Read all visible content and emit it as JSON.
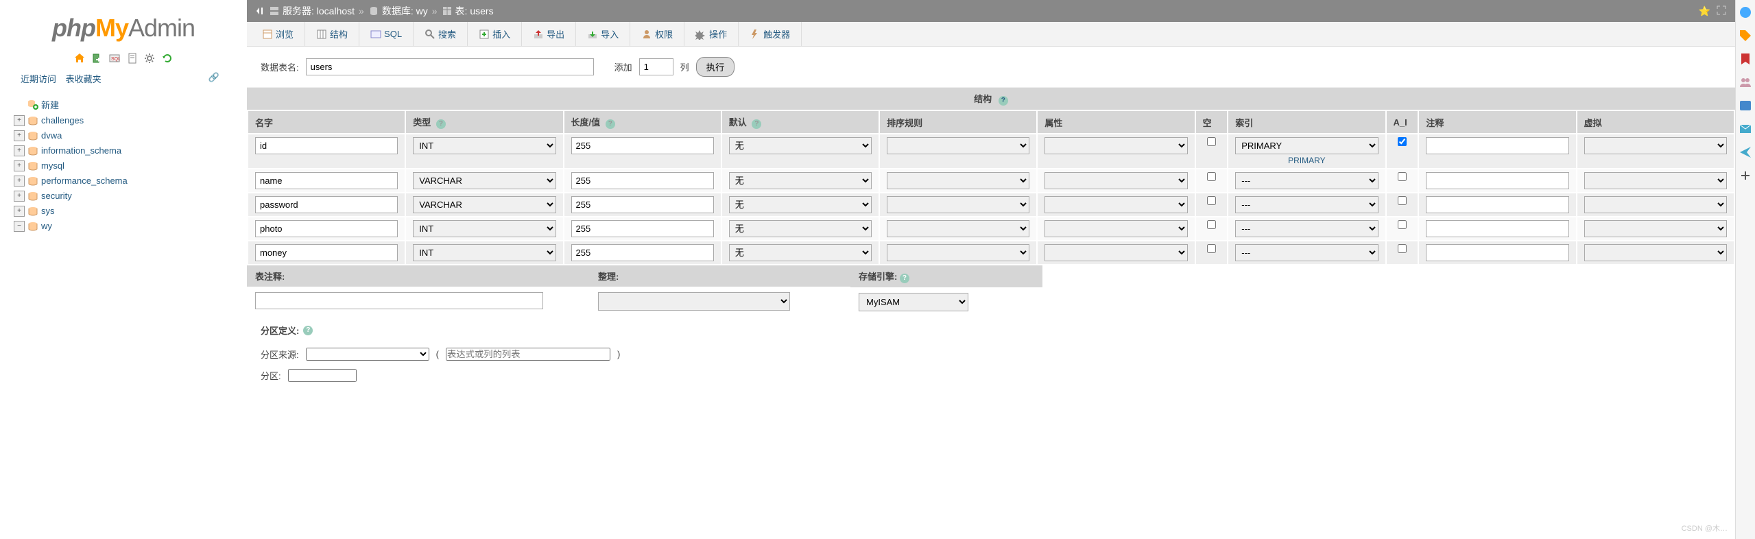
{
  "logo": {
    "part1": "php",
    "part2": "My",
    "part3": "Admin"
  },
  "nav_side": {
    "recent": "近期访问",
    "favorites": "表收藏夹"
  },
  "tree": {
    "new": "新建",
    "dbs": [
      "challenges",
      "dvwa",
      "information_schema",
      "mysql",
      "performance_schema",
      "security",
      "sys",
      "wy"
    ]
  },
  "breadcrumb": {
    "server_label": "服务器:",
    "server": "localhost",
    "db_label": "数据库:",
    "db": "wy",
    "table_label": "表:",
    "table": "users"
  },
  "tabs": [
    "浏览",
    "结构",
    "SQL",
    "搜索",
    "插入",
    "导出",
    "导入",
    "权限",
    "操作",
    "触发器"
  ],
  "form": {
    "table_name_label": "数据表名:",
    "table_name": "users",
    "add_label": "添加",
    "add_count": "1",
    "columns_label": "列",
    "execute": "执行"
  },
  "structure": {
    "title": "结构",
    "headers": {
      "name": "名字",
      "type": "类型",
      "length": "长度/值",
      "default": "默认",
      "collation": "排序规则",
      "attributes": "属性",
      "null": "空",
      "index": "索引",
      "ai": "A_I",
      "comments": "注释",
      "virtual": "虚拟"
    },
    "primary_label": "PRIMARY",
    "rows": [
      {
        "name": "id",
        "type": "INT",
        "len": "255",
        "def": "无",
        "idx": "PRIMARY",
        "ai": true
      },
      {
        "name": "name",
        "type": "VARCHAR",
        "len": "255",
        "def": "无",
        "idx": "---",
        "ai": false
      },
      {
        "name": "password",
        "type": "VARCHAR",
        "len": "255",
        "def": "无",
        "idx": "---",
        "ai": false
      },
      {
        "name": "photo",
        "type": "INT",
        "len": "255",
        "def": "无",
        "idx": "---",
        "ai": false
      },
      {
        "name": "money",
        "type": "INT",
        "len": "255",
        "def": "无",
        "idx": "---",
        "ai": false
      }
    ]
  },
  "lower": {
    "comment_label": "表注释:",
    "collation_label": "整理:",
    "engine_label": "存储引擎:",
    "engine": "MyISAM"
  },
  "partition": {
    "title": "分区定义:",
    "source_label": "分区来源:",
    "expr_placeholder": "表达式或列的列表",
    "count_label": "分区:"
  },
  "watermark": "CSDN @木…"
}
